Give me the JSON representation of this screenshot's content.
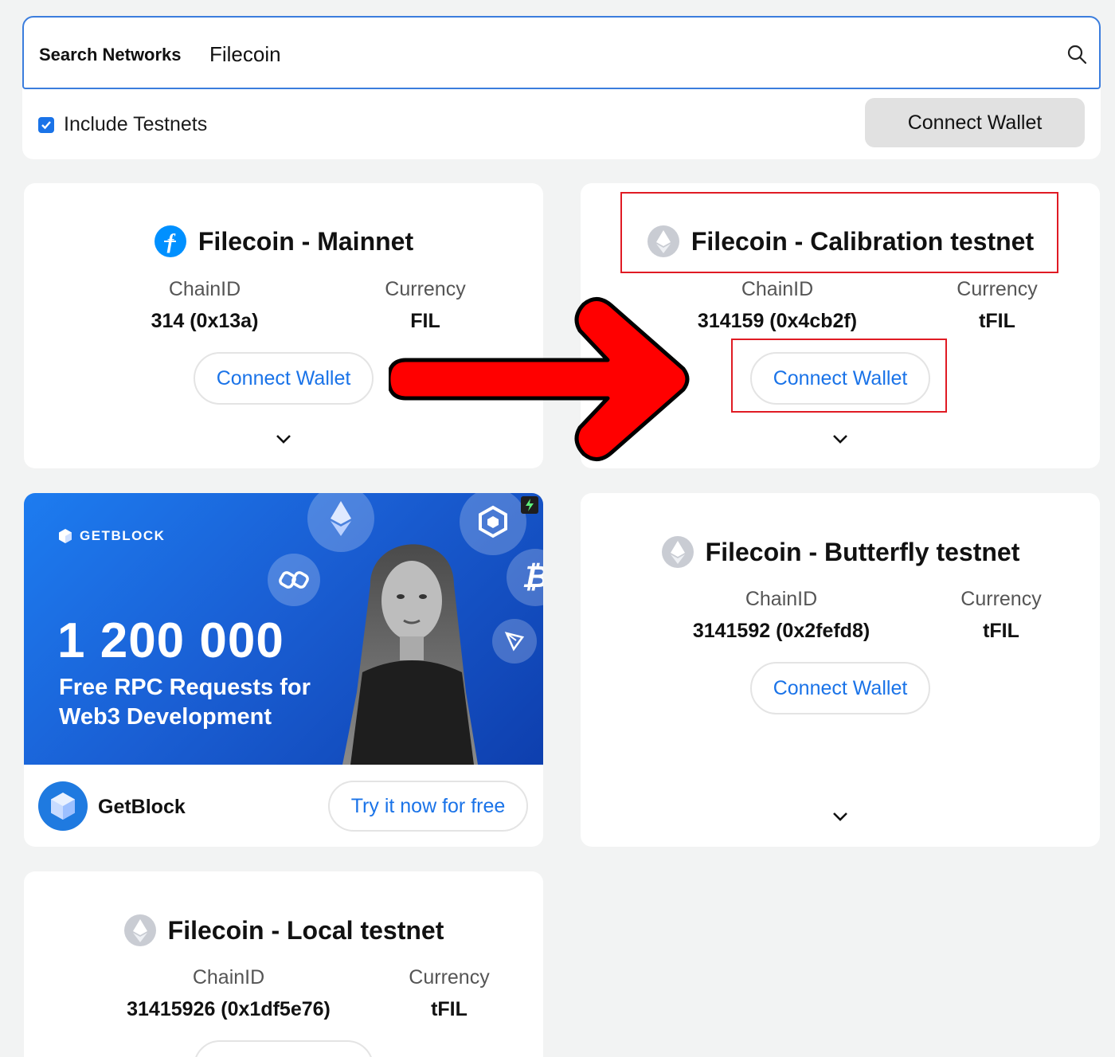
{
  "search": {
    "label": "Search Networks",
    "value": "Filecoin",
    "placeholder": ""
  },
  "filters": {
    "include_testnets_label": "Include Testnets",
    "include_testnets_checked": true
  },
  "header": {
    "connect_label": "Connect Wallet"
  },
  "labels": {
    "chain_id": "ChainID",
    "currency": "Currency",
    "connect": "Connect Wallet"
  },
  "networks": [
    {
      "name": "Filecoin - Mainnet",
      "chain_id": "314 (0x13a)",
      "currency": "FIL",
      "icon": "filecoin-icon"
    },
    {
      "name": "Filecoin - Calibration testnet",
      "chain_id": "314159 (0x4cb2f)",
      "currency": "tFIL",
      "icon": "ethereum-icon"
    },
    {
      "name": "Filecoin - Butterfly testnet",
      "chain_id": "3141592 (0x2fefd8)",
      "currency": "tFIL",
      "icon": "ethereum-icon"
    },
    {
      "name": "Filecoin - Local testnet",
      "chain_id": "31415926 (0x1df5e76)",
      "currency": "tFIL",
      "icon": "ethereum-icon"
    }
  ],
  "ad": {
    "brand": "GETBLOCK",
    "headline": "1 200 000",
    "subline": "Free RPC Requests for Web3 Development",
    "advertiser": "GetBlock",
    "cta": "Try it now for free"
  },
  "colors": {
    "accent": "#1a73e8",
    "annotation": "#e01b24",
    "arrow_fill": "#ff0000",
    "ad_blue": "#1a5fd4"
  }
}
